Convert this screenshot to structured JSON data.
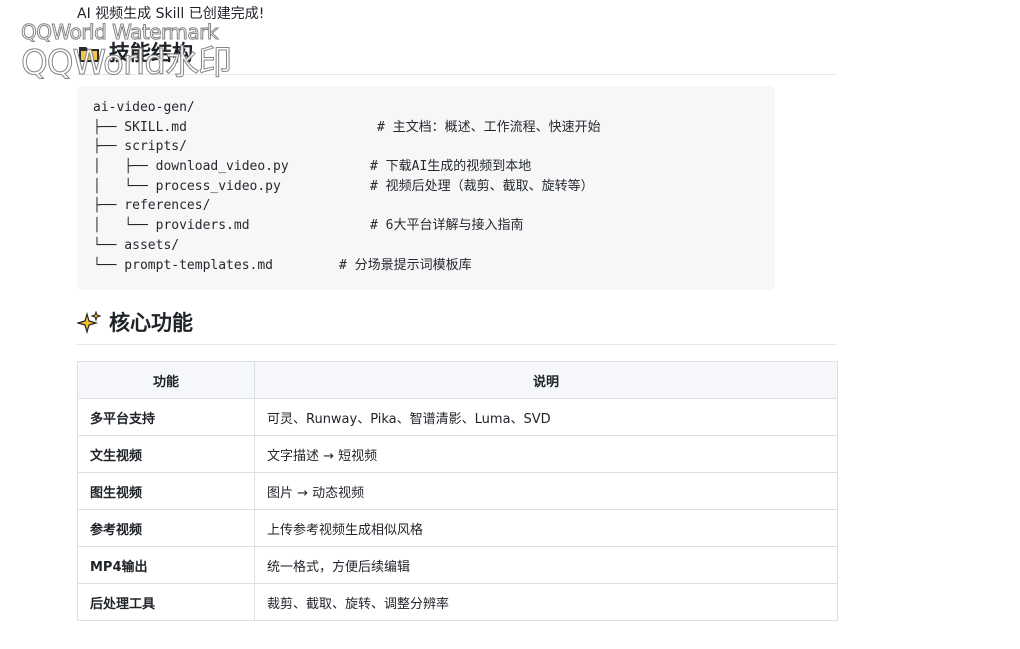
{
  "intro_text": "AI 视频生成 Skill 已创建完成!",
  "watermark": {
    "line1": "QQWorld Watermark",
    "line2": "QQWorld水印"
  },
  "structure_section": {
    "title": "技能结构",
    "icon": "folder-icon",
    "code_lines": [
      {
        "tree": "ai-video-gen/",
        "comment": ""
      },
      {
        "tree": "├── SKILL.md",
        "comment": "# 主文档：概述、工作流程、快速开始"
      },
      {
        "tree": "├── scripts/",
        "comment": ""
      },
      {
        "tree": "│   ├── download_video.py",
        "comment": "# 下载AI生成的视频到本地"
      },
      {
        "tree": "│   └── process_video.py",
        "comment": "# 视频后处理（裁剪、截取、旋转等）"
      },
      {
        "tree": "├── references/",
        "comment": ""
      },
      {
        "tree": "│   └── providers.md",
        "comment": "# 6大平台详解与接入指南"
      },
      {
        "tree": "└── assets/",
        "comment": ""
      },
      {
        "tree": "└── prompt-templates.md",
        "comment": "# 分场景提示词模板库"
      }
    ]
  },
  "features_section": {
    "title": "核心功能",
    "icon": "sparkles-icon",
    "headers": [
      "功能",
      "说明"
    ],
    "rows": [
      [
        "多平台支持",
        "可灵、Runway、Pika、智谱清影、Luma、SVD"
      ],
      [
        "文生视频",
        "文字描述 → 短视频"
      ],
      [
        "图生视频",
        "图片 → 动态视频"
      ],
      [
        "参考视频",
        "上传参考视频生成相似风格"
      ],
      [
        "MP4输出",
        "统一格式，方便后续编辑"
      ],
      [
        "后处理工具",
        "裁剪、截取、旋转、调整分辨率"
      ]
    ]
  },
  "colors": {
    "code_bg": "#f7f7f8",
    "table_header_bg": "#f5f7fa",
    "border": "#dcdfe3"
  }
}
